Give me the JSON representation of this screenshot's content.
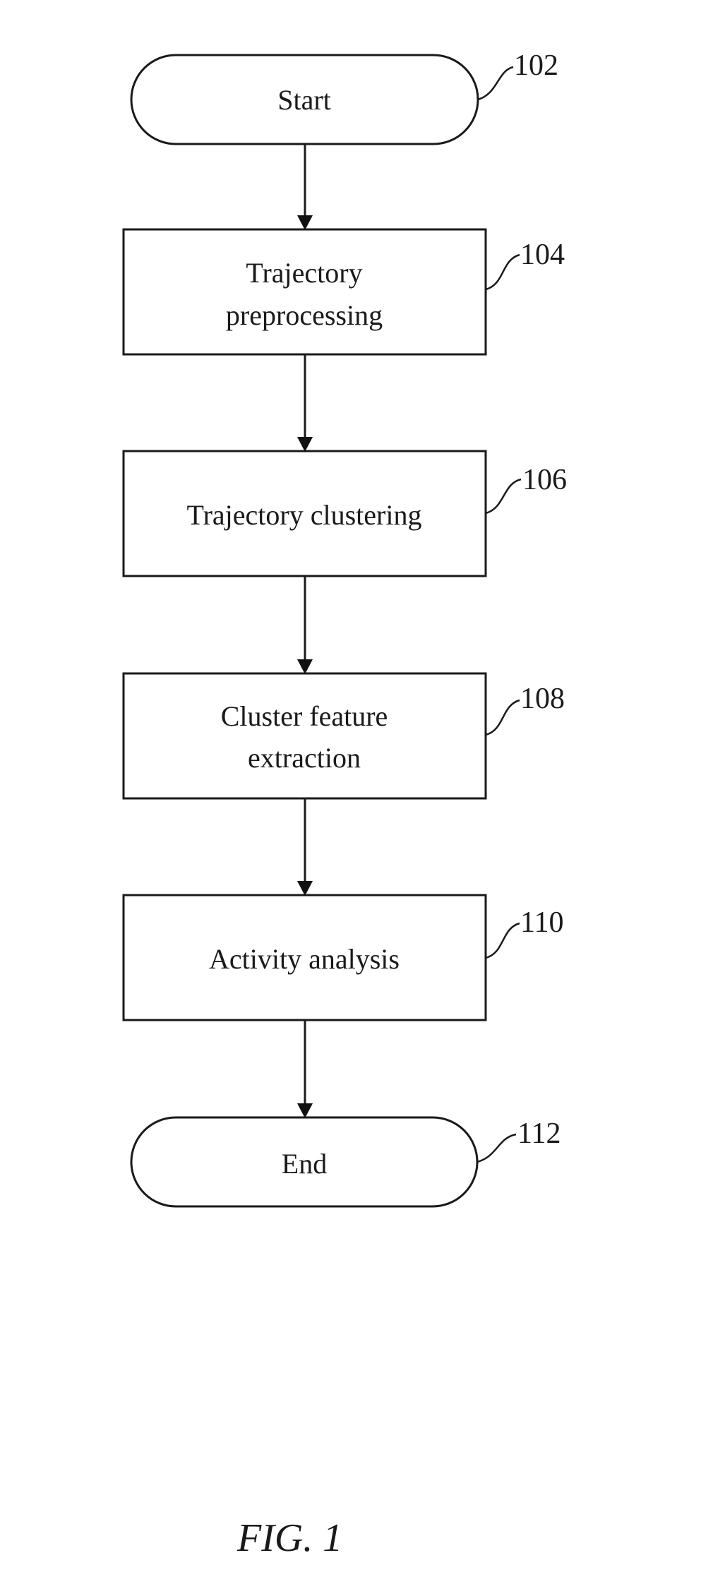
{
  "figure": {
    "caption": "FIG. 1",
    "steps": [
      {
        "ref": "102",
        "type": "terminator",
        "lines": [
          "Start"
        ]
      },
      {
        "ref": "104",
        "type": "process",
        "lines": [
          "Trajectory",
          "preprocessing"
        ]
      },
      {
        "ref": "106",
        "type": "process",
        "lines": [
          "Trajectory clustering"
        ]
      },
      {
        "ref": "108",
        "type": "process",
        "lines": [
          "Cluster feature",
          "extraction"
        ]
      },
      {
        "ref": "110",
        "type": "process",
        "lines": [
          "Activity analysis"
        ]
      },
      {
        "ref": "112",
        "type": "terminator",
        "lines": [
          "End"
        ]
      }
    ],
    "connections": [
      {
        "from": "102",
        "to": "104"
      },
      {
        "from": "104",
        "to": "106"
      },
      {
        "from": "106",
        "to": "108"
      },
      {
        "from": "108",
        "to": "110"
      },
      {
        "from": "110",
        "to": "112"
      }
    ]
  }
}
